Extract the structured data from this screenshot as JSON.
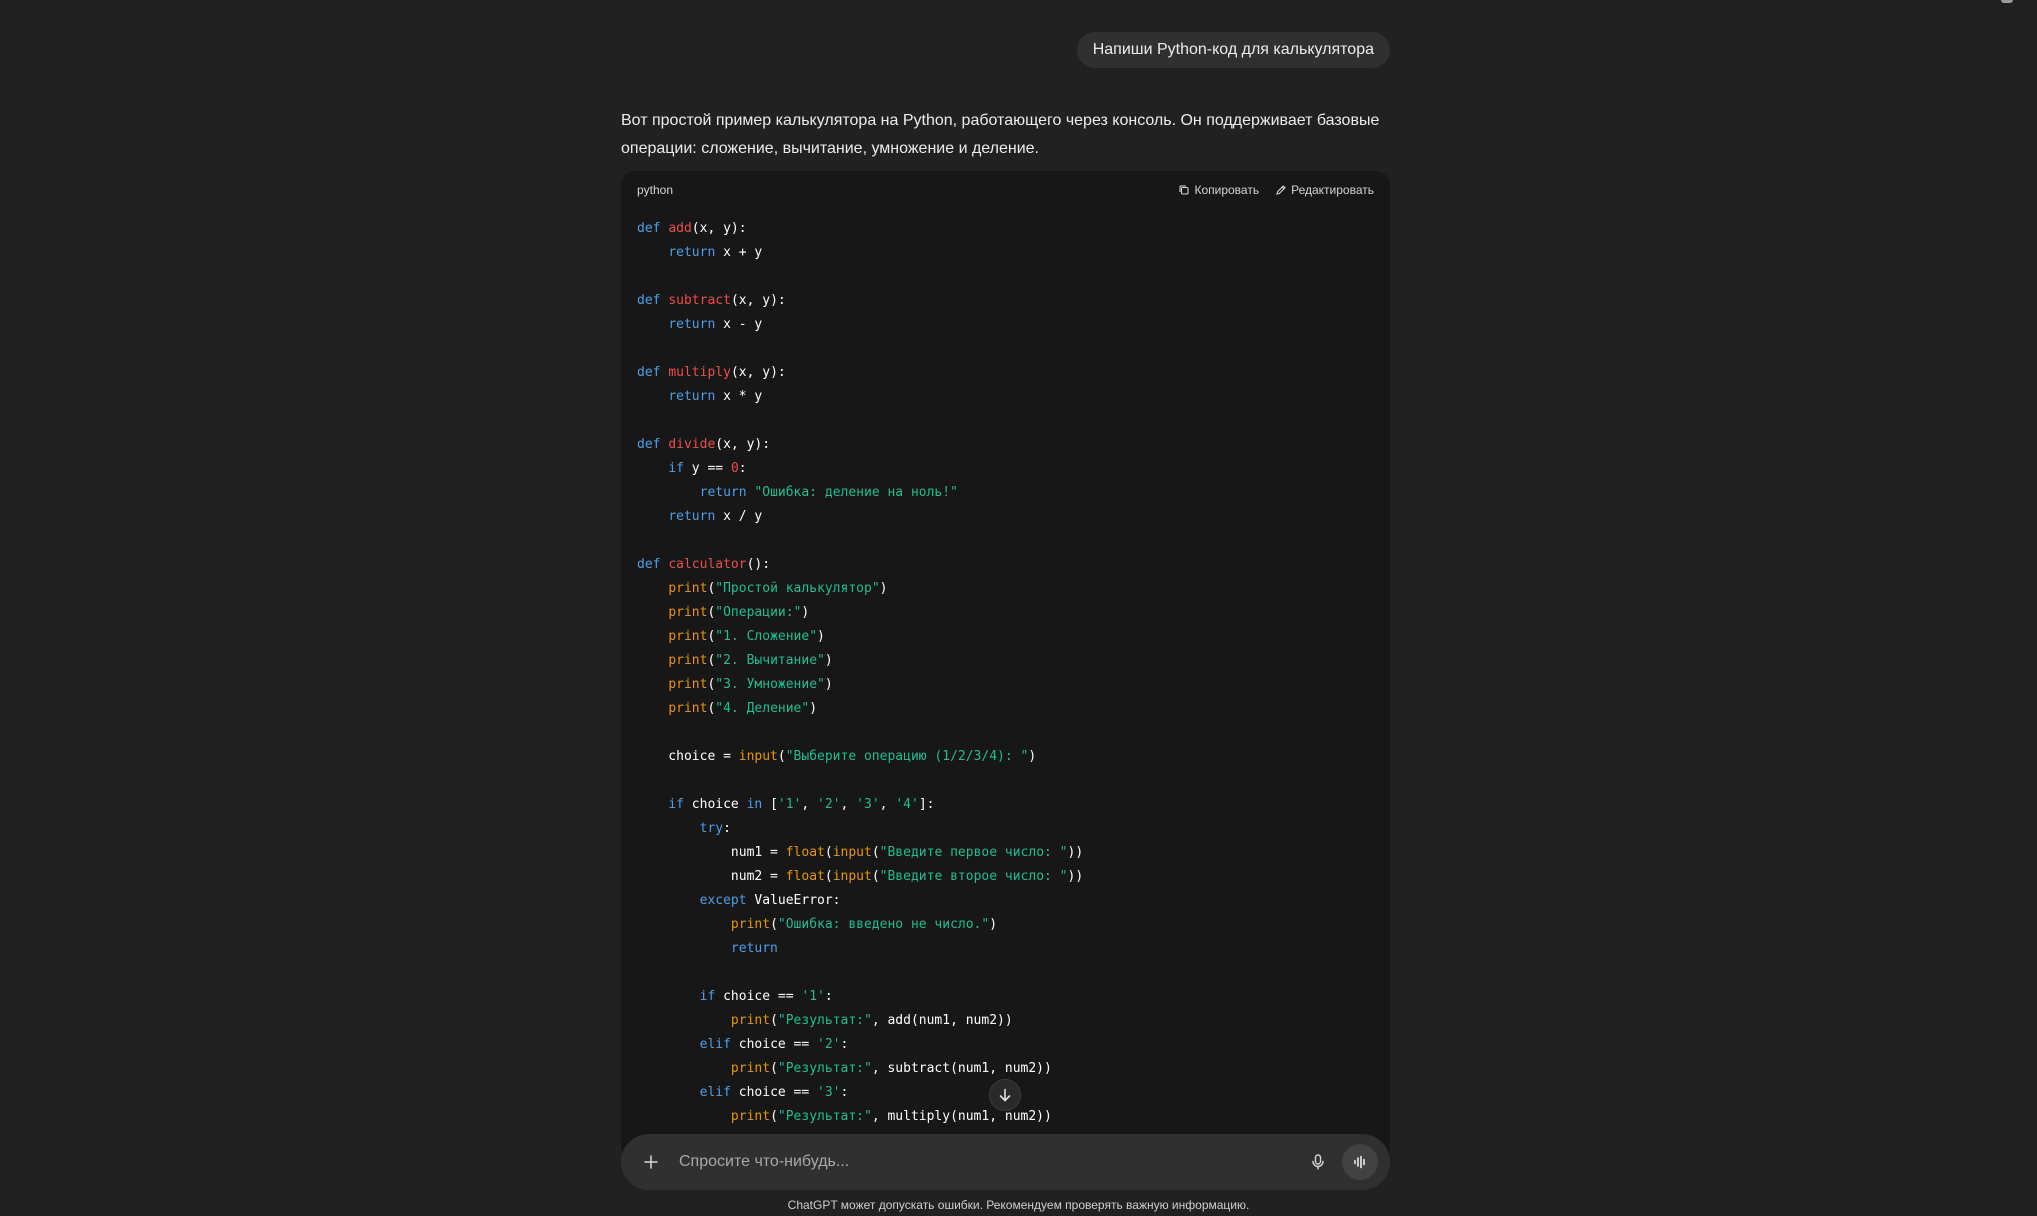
{
  "user_message": "Напиши Python-код для калькулятора",
  "assistant": {
    "intro": "Вот простой пример калькулятора на Python, работающего через консоль. Он поддерживает базовые операции: сложение, вычитание, умножение и деление."
  },
  "code_block": {
    "language": "python",
    "copy_label": "Копировать",
    "edit_label": "Редактировать",
    "strings": {
      "s1": "\"Ошибка: деление на ноль!\"",
      "s2": "\"Простой калькулятор\"",
      "s3": "\"Операции:\"",
      "s4": "\"1. Сложение\"",
      "s5": "\"2. Вычитание\"",
      "s6": "\"3. Умножение\"",
      "s7": "\"4. Деление\"",
      "s8": "\"Выберите операцию (1/2/3/4): \"",
      "s9": "\"Введите первое число: \"",
      "s10": "\"Введите второе число: \"",
      "s11": "\"Ошибка: введено не число.\"",
      "s12": "\"Результат:\""
    }
  },
  "composer": {
    "placeholder": "Спросите что-нибудь..."
  },
  "footer": {
    "disclaimer": "ChatGPT может допускать ошибки. Рекомендуем проверять важную информацию."
  },
  "icons": {
    "copy": "copy-icon",
    "edit": "pencil-icon",
    "plus": "plus-icon",
    "mic": "microphone-icon",
    "voice": "voice-waveform-icon",
    "scroll": "arrow-down-icon"
  }
}
